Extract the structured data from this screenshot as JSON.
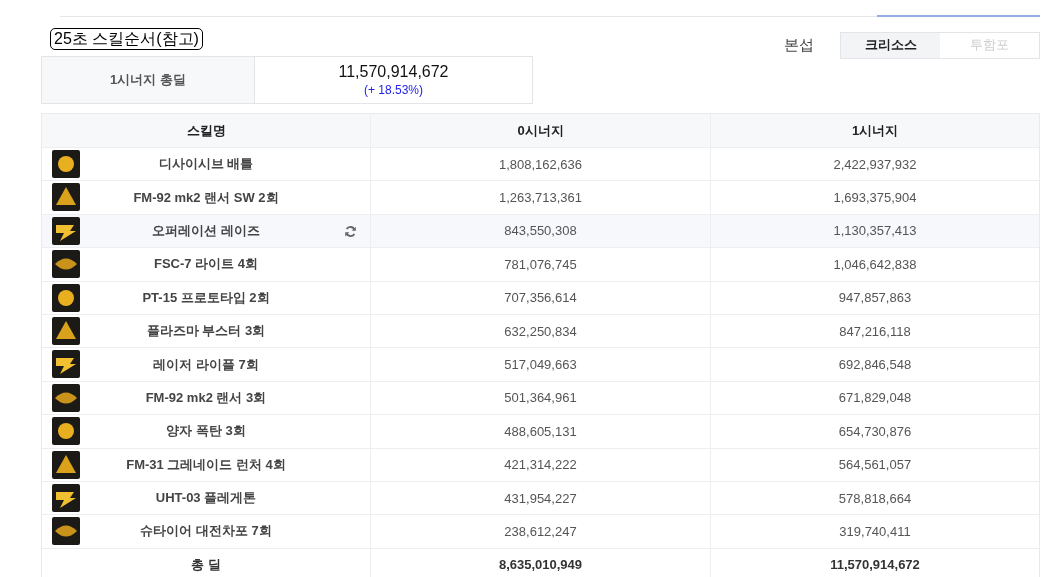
{
  "tabs": [
    {
      "selected": false
    },
    {
      "selected": false
    },
    {
      "selected": false
    },
    {
      "selected": false
    },
    {
      "selected": false
    },
    {
      "selected": true
    }
  ],
  "title": "25초 스킬순서(참고)",
  "option": {
    "label": "본섭",
    "choices": [
      {
        "label": "크리소스",
        "selected": true
      },
      {
        "label": "투함포",
        "selected": false
      }
    ]
  },
  "summary": {
    "label": "1시너지 총딜",
    "value": "11,570,914,672",
    "delta": "(+ 18.53%)"
  },
  "table": {
    "columns": [
      "스킬명",
      "0시너지",
      "1시너지"
    ],
    "rows": [
      {
        "name": "디사이시브 배틀",
        "v0": "1,808,162,636",
        "v1": "2,422,937,932",
        "highlighted": false,
        "swap_icon": false
      },
      {
        "name": "FM-92 mk2 랜서 SW 2회",
        "v0": "1,263,713,361",
        "v1": "1,693,375,904",
        "highlighted": false,
        "swap_icon": false
      },
      {
        "name": "오퍼레이션 레이즈",
        "v0": "843,550,308",
        "v1": "1,130,357,413",
        "highlighted": true,
        "swap_icon": true
      },
      {
        "name": "FSC-7 라이트 4회",
        "v0": "781,076,745",
        "v1": "1,046,642,838",
        "highlighted": false,
        "swap_icon": false
      },
      {
        "name": "PT-15 프로토타입 2회",
        "v0": "707,356,614",
        "v1": "947,857,863",
        "highlighted": false,
        "swap_icon": false
      },
      {
        "name": "플라즈마 부스터 3회",
        "v0": "632,250,834",
        "v1": "847,216,118",
        "highlighted": false,
        "swap_icon": false
      },
      {
        "name": "레이저 라이플 7회",
        "v0": "517,049,663",
        "v1": "692,846,548",
        "highlighted": false,
        "swap_icon": false
      },
      {
        "name": "FM-92 mk2 랜서 3회",
        "v0": "501,364,961",
        "v1": "671,829,048",
        "highlighted": false,
        "swap_icon": false
      },
      {
        "name": "양자 폭탄 3회",
        "v0": "488,605,131",
        "v1": "654,730,876",
        "highlighted": false,
        "swap_icon": false
      },
      {
        "name": "FM-31 그레네이드 런처 4회",
        "v0": "421,314,222",
        "v1": "564,561,057",
        "highlighted": false,
        "swap_icon": false
      },
      {
        "name": "UHT-03 플레게톤",
        "v0": "431,954,227",
        "v1": "578,818,664",
        "highlighted": false,
        "swap_icon": false
      },
      {
        "name": "슈타이어 대전차포 7회",
        "v0": "238,612,247",
        "v1": "319,740,411",
        "highlighted": false,
        "swap_icon": false
      }
    ],
    "total": {
      "label": "총 딜",
      "v0": "8,635,010,949",
      "v1": "11,570,914,672"
    }
  }
}
